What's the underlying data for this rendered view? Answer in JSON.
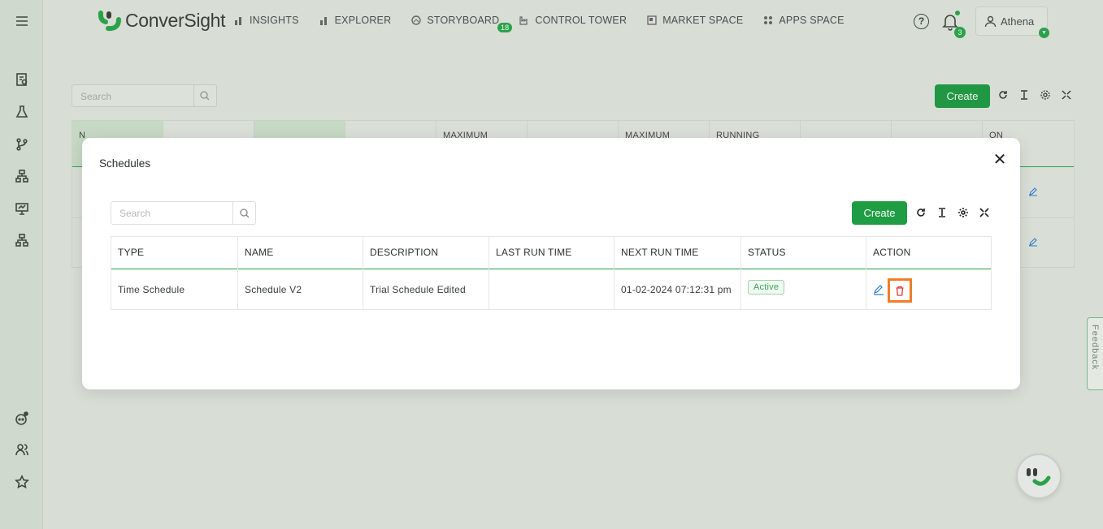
{
  "app": {
    "name": "ConverSight"
  },
  "nav": {
    "items": [
      {
        "label": "INSIGHTS",
        "icon": "bar-chart-icon"
      },
      {
        "label": "EXPLORER",
        "icon": "bar-chart-icon"
      },
      {
        "label": "STORYBOARD",
        "icon": "storyboard-icon",
        "badge": "18"
      },
      {
        "label": "CONTROL TOWER",
        "icon": "factory-icon"
      },
      {
        "label": "MARKET SPACE",
        "icon": "market-icon"
      },
      {
        "label": "APPS SPACE",
        "icon": "apps-grid-icon"
      }
    ]
  },
  "header": {
    "notifications_count": "3",
    "user_name": "Athena"
  },
  "background_page": {
    "search_placeholder": "Search",
    "create_label": "Create",
    "columns": [
      "N",
      "",
      "",
      "",
      "MAXIMUM",
      "",
      "MAXIMUM",
      "RUNNING",
      "",
      "",
      "ON"
    ]
  },
  "modal": {
    "title": "Schedules",
    "search_placeholder": "Search",
    "create_label": "Create",
    "columns": [
      "TYPE",
      "NAME",
      "DESCRIPTION",
      "LAST RUN TIME",
      "NEXT RUN TIME",
      "STATUS",
      "ACTION"
    ],
    "rows": [
      {
        "type": "Time Schedule",
        "name": "Schedule V2",
        "description": "Trial Schedule Edited",
        "last_run_time": "",
        "next_run_time": "01-02-2024 07:12:31 pm",
        "status": "Active"
      }
    ]
  },
  "feedback_label": "Feedback",
  "colors": {
    "accent": "#1f9d44",
    "delete": "#e53935",
    "highlight": "#f07d28",
    "edit": "#2f7fd0"
  }
}
